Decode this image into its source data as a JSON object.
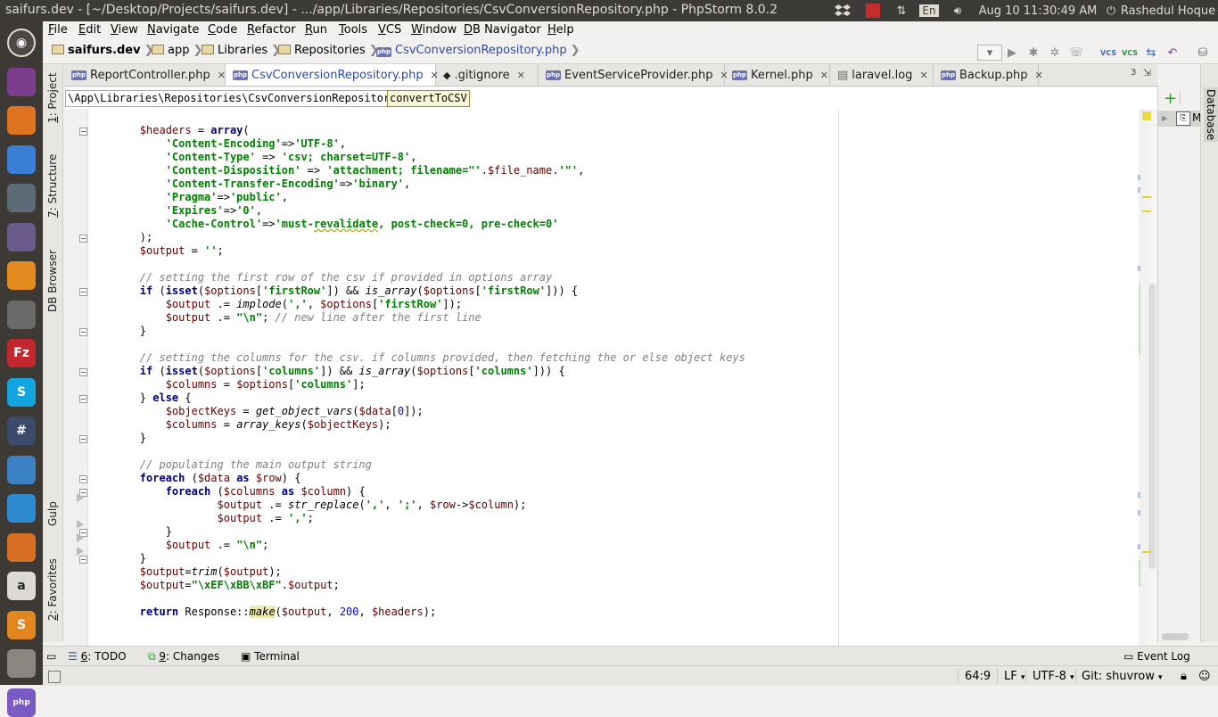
{
  "window": {
    "title": "saifurs.dev - [~/Desktop/Projects/saifurs.dev] - .../app/Libraries/Repositories/CsvConversionRepository.php - PhpStorm 8.0.2"
  },
  "tray": {
    "keyboard_layout": "En",
    "clock": "Aug 10 11:30:49 AM",
    "user": "Rashedul Hoque"
  },
  "menu": [
    "File",
    "Edit",
    "View",
    "Navigate",
    "Code",
    "Refactor",
    "Run",
    "Tools",
    "VCS",
    "Window",
    "DB Navigator",
    "Help"
  ],
  "breadcrumb": {
    "project": "saifurs.dev",
    "items": [
      "app",
      "Libraries",
      "Repositories"
    ],
    "file": "CsvConversionRepository.php"
  },
  "toolbar": {
    "vcs_label": "VCS"
  },
  "tabs": [
    {
      "label": "ReportController.php",
      "icon": "php-file-icon"
    },
    {
      "label": "CsvConversionRepository.php",
      "icon": "php-file-icon",
      "active": true
    },
    {
      "label": ".gitignore",
      "icon": "git-icon"
    },
    {
      "label": "EventServiceProvider.php",
      "icon": "php-file-icon"
    },
    {
      "label": "Kernel.php",
      "icon": "php-file-icon"
    },
    {
      "label": "laravel.log",
      "icon": "text-file-icon"
    },
    {
      "label": "Backup.php",
      "icon": "php-file-icon"
    }
  ],
  "tab_overflow": "3",
  "code_breadcrumb": {
    "class_path": "\\App\\Libraries\\Repositories\\CsvConversionRepository",
    "method": "convertToCSV"
  },
  "left_tools": [
    {
      "num": "1",
      "label": "Project"
    },
    {
      "num": "7",
      "label": "Structure"
    },
    {
      "num": "",
      "label": "DB Browser"
    },
    {
      "num": "",
      "label": "Gulp"
    },
    {
      "num": "2",
      "label": "Favorites"
    }
  ],
  "right_tools": [
    {
      "label": "Database"
    }
  ],
  "db_panel": {
    "node_label": "M"
  },
  "bottom_tools": [
    {
      "num": "6",
      "label": "TODO"
    },
    {
      "num": "9",
      "label": "Changes"
    },
    {
      "num": "",
      "label": "Terminal"
    }
  ],
  "event_log": "Event Log",
  "status": {
    "position": "64:9",
    "line_sep": "LF",
    "encoding": "UTF-8",
    "git": "Git: shuvrow"
  },
  "launcher": [
    {
      "name": "ubuntu-dash-icon",
      "bg": "#4b4945"
    },
    {
      "name": "files-icon",
      "bg": "#7a3e8c"
    },
    {
      "name": "firefox-icon",
      "bg": "#e0731f"
    },
    {
      "name": "chrome-icon",
      "bg": "#3a7ed5"
    },
    {
      "name": "app-grid-icon",
      "bg": "#5d6a78"
    },
    {
      "name": "atom-icon",
      "bg": "#6a5b8c"
    },
    {
      "name": "avast-icon",
      "bg": "#e38b1f"
    },
    {
      "name": "toggle-icon",
      "bg": "#6a6a6a"
    },
    {
      "name": "filezilla-icon",
      "bg": "#c1272d",
      "text": "Fz"
    },
    {
      "name": "skype-icon",
      "bg": "#12a5e0",
      "text": "S"
    },
    {
      "name": "slack-icon",
      "bg": "#3c4a6c",
      "text": "#"
    },
    {
      "name": "text-editor-icon",
      "bg": "#3b82c4"
    },
    {
      "name": "lifebuoy-icon",
      "bg": "#2d8bd1"
    },
    {
      "name": "gimp-icon",
      "bg": "#d96f25"
    },
    {
      "name": "amazon-icon",
      "bg": "#dcdad6",
      "text": "a"
    },
    {
      "name": "sublime-icon",
      "bg": "#e2871f",
      "text": "S"
    },
    {
      "name": "storage-icon",
      "bg": "#8a8780"
    },
    {
      "name": "phpstorm-icon",
      "bg": "#7a5bc4",
      "text": "php"
    }
  ],
  "code_lines": [
    [
      {
        "t": "        "
      },
      {
        "c": "vr",
        "t": "$headers"
      },
      {
        "t": " = "
      },
      {
        "c": "kw",
        "t": "array"
      },
      {
        "t": "("
      }
    ],
    [
      {
        "t": "            "
      },
      {
        "c": "st",
        "t": "'Content-Encoding'"
      },
      {
        "t": "=>"
      },
      {
        "c": "st",
        "t": "'UTF-8'"
      },
      {
        "t": ","
      }
    ],
    [
      {
        "t": "            "
      },
      {
        "c": "st",
        "t": "'Content-Type'"
      },
      {
        "t": " => "
      },
      {
        "c": "st",
        "t": "'csv; charset=UTF-8'"
      },
      {
        "t": ","
      }
    ],
    [
      {
        "t": "            "
      },
      {
        "c": "st",
        "t": "'Content-Disposition'"
      },
      {
        "t": " => "
      },
      {
        "c": "st",
        "t": "'attachment; filename=\"'"
      },
      {
        "t": "."
      },
      {
        "c": "vr",
        "t": "$file_name"
      },
      {
        "t": "."
      },
      {
        "c": "st",
        "t": "'\"'"
      },
      {
        "t": ","
      }
    ],
    [
      {
        "t": "            "
      },
      {
        "c": "st",
        "t": "'Content-Transfer-Encoding'"
      },
      {
        "t": "=>"
      },
      {
        "c": "st",
        "t": "'binary'"
      },
      {
        "t": ","
      }
    ],
    [
      {
        "t": "            "
      },
      {
        "c": "st",
        "t": "'Pragma'"
      },
      {
        "t": "=>"
      },
      {
        "c": "st",
        "t": "'public'"
      },
      {
        "t": ","
      }
    ],
    [
      {
        "t": "            "
      },
      {
        "c": "st",
        "t": "'Expires'"
      },
      {
        "t": "=>"
      },
      {
        "c": "st",
        "t": "'0'"
      },
      {
        "t": ","
      }
    ],
    [
      {
        "t": "            "
      },
      {
        "c": "st",
        "t": "'Cache-Control'"
      },
      {
        "t": "=>"
      },
      {
        "c": "st",
        "t": "'must-"
      },
      {
        "c": "st squig",
        "t": "revalidate"
      },
      {
        "c": "st",
        "t": ", post-check=0, pre-check=0'"
      }
    ],
    [
      {
        "t": "        );"
      }
    ],
    [
      {
        "t": "        "
      },
      {
        "c": "vr",
        "t": "$output"
      },
      {
        "t": " = "
      },
      {
        "c": "st",
        "t": "''"
      },
      {
        "t": ";"
      }
    ],
    [],
    [
      {
        "t": "        "
      },
      {
        "c": "cm",
        "t": "// setting the first row of the csv if provided in options array"
      }
    ],
    [
      {
        "t": "        "
      },
      {
        "c": "kw",
        "t": "if"
      },
      {
        "t": " ("
      },
      {
        "c": "kw",
        "t": "isset"
      },
      {
        "t": "("
      },
      {
        "c": "vr",
        "t": "$options"
      },
      {
        "t": "["
      },
      {
        "c": "st",
        "t": "'firstRow'"
      },
      {
        "t": "]) && "
      },
      {
        "c": "fn",
        "t": "is_array"
      },
      {
        "t": "("
      },
      {
        "c": "vr",
        "t": "$options"
      },
      {
        "t": "["
      },
      {
        "c": "st",
        "t": "'firstRow'"
      },
      {
        "t": "])) {"
      }
    ],
    [
      {
        "t": "            "
      },
      {
        "c": "vr",
        "t": "$output"
      },
      {
        "t": " .= "
      },
      {
        "c": "fn",
        "t": "implode"
      },
      {
        "t": "("
      },
      {
        "c": "st",
        "t": "','"
      },
      {
        "t": ", "
      },
      {
        "c": "vr",
        "t": "$options"
      },
      {
        "t": "["
      },
      {
        "c": "st",
        "t": "'firstRow'"
      },
      {
        "t": "]);"
      }
    ],
    [
      {
        "t": "            "
      },
      {
        "c": "vr",
        "t": "$output"
      },
      {
        "t": " .= "
      },
      {
        "c": "st",
        "t": "\"\\n\""
      },
      {
        "t": "; "
      },
      {
        "c": "cm",
        "t": "// new line after the first line"
      }
    ],
    [
      {
        "t": "        }"
      }
    ],
    [],
    [
      {
        "t": "        "
      },
      {
        "c": "cm",
        "t": "// setting the columns for the csv. if columns provided, then fetching the or else object keys"
      }
    ],
    [
      {
        "t": "        "
      },
      {
        "c": "kw",
        "t": "if"
      },
      {
        "t": " ("
      },
      {
        "c": "kw",
        "t": "isset"
      },
      {
        "t": "("
      },
      {
        "c": "vr",
        "t": "$options"
      },
      {
        "t": "["
      },
      {
        "c": "st",
        "t": "'columns'"
      },
      {
        "t": "]) && "
      },
      {
        "c": "fn",
        "t": "is_array"
      },
      {
        "t": "("
      },
      {
        "c": "vr",
        "t": "$options"
      },
      {
        "t": "["
      },
      {
        "c": "st",
        "t": "'columns'"
      },
      {
        "t": "])) {"
      }
    ],
    [
      {
        "t": "            "
      },
      {
        "c": "vr",
        "t": "$columns"
      },
      {
        "t": " = "
      },
      {
        "c": "vr",
        "t": "$options"
      },
      {
        "t": "["
      },
      {
        "c": "st",
        "t": "'columns'"
      },
      {
        "t": "];"
      }
    ],
    [
      {
        "t": "        } "
      },
      {
        "c": "kw",
        "t": "else"
      },
      {
        "t": " {"
      }
    ],
    [
      {
        "t": "            "
      },
      {
        "c": "vr",
        "t": "$objectKeys"
      },
      {
        "t": " = "
      },
      {
        "c": "fn",
        "t": "get_object_vars"
      },
      {
        "t": "("
      },
      {
        "c": "vr",
        "t": "$data"
      },
      {
        "t": "["
      },
      {
        "c": "nm",
        "t": "0"
      },
      {
        "t": "]);"
      }
    ],
    [
      {
        "t": "            "
      },
      {
        "c": "vr",
        "t": "$columns"
      },
      {
        "t": " = "
      },
      {
        "c": "fn",
        "t": "array_keys"
      },
      {
        "t": "("
      },
      {
        "c": "vr",
        "t": "$objectKeys"
      },
      {
        "t": ");"
      }
    ],
    [
      {
        "t": "        }"
      }
    ],
    [],
    [
      {
        "t": "        "
      },
      {
        "c": "cm",
        "t": "// populating the main output string"
      }
    ],
    [
      {
        "t": "        "
      },
      {
        "c": "kw",
        "t": "foreach"
      },
      {
        "t": " ("
      },
      {
        "c": "vr",
        "t": "$data"
      },
      {
        "t": " "
      },
      {
        "c": "kw",
        "t": "as"
      },
      {
        "t": " "
      },
      {
        "c": "vr",
        "t": "$row"
      },
      {
        "t": ") {"
      }
    ],
    [
      {
        "t": "            "
      },
      {
        "c": "kw",
        "t": "foreach"
      },
      {
        "t": " ("
      },
      {
        "c": "vr",
        "t": "$columns"
      },
      {
        "t": " "
      },
      {
        "c": "kw",
        "t": "as"
      },
      {
        "t": " "
      },
      {
        "c": "vr",
        "t": "$column"
      },
      {
        "t": ") {"
      }
    ],
    [
      {
        "t": "                    "
      },
      {
        "c": "vr",
        "t": "$output"
      },
      {
        "t": " .= "
      },
      {
        "c": "fn",
        "t": "str_replace"
      },
      {
        "t": "("
      },
      {
        "c": "st",
        "t": "','"
      },
      {
        "t": ", "
      },
      {
        "c": "st",
        "t": "';'"
      },
      {
        "t": ", "
      },
      {
        "c": "vr",
        "t": "$row"
      },
      {
        "t": "->"
      },
      {
        "c": "vr",
        "t": "$column"
      },
      {
        "t": ");"
      }
    ],
    [
      {
        "t": "                    "
      },
      {
        "c": "vr",
        "t": "$output"
      },
      {
        "t": " .= "
      },
      {
        "c": "st",
        "t": "','"
      },
      {
        "t": ";"
      }
    ],
    [
      {
        "t": "            }"
      }
    ],
    [
      {
        "t": "            "
      },
      {
        "c": "vr",
        "t": "$output"
      },
      {
        "t": " .= "
      },
      {
        "c": "st",
        "t": "\"\\n\""
      },
      {
        "t": ";"
      }
    ],
    [
      {
        "t": "        }"
      }
    ],
    [
      {
        "t": "        "
      },
      {
        "c": "vr",
        "t": "$output"
      },
      {
        "t": "="
      },
      {
        "c": "fn",
        "t": "trim"
      },
      {
        "t": "("
      },
      {
        "c": "vr",
        "t": "$output"
      },
      {
        "t": ");"
      }
    ],
    [
      {
        "t": "        "
      },
      {
        "c": "vr",
        "t": "$output"
      },
      {
        "t": "="
      },
      {
        "c": "st",
        "t": "\"\\xEF\\xBB\\xBF\""
      },
      {
        "t": "."
      },
      {
        "c": "vr",
        "t": "$output"
      },
      {
        "t": ";"
      }
    ],
    [],
    [
      {
        "t": "        "
      },
      {
        "c": "kw",
        "t": "return"
      },
      {
        "t": " Response::"
      },
      {
        "c": "fn hl",
        "t": "make"
      },
      {
        "t": "("
      },
      {
        "c": "vr",
        "t": "$output"
      },
      {
        "t": ", "
      },
      {
        "c": "nm",
        "t": "200"
      },
      {
        "t": ", "
      },
      {
        "c": "vr",
        "t": "$headers"
      },
      {
        "t": ");"
      }
    ]
  ]
}
